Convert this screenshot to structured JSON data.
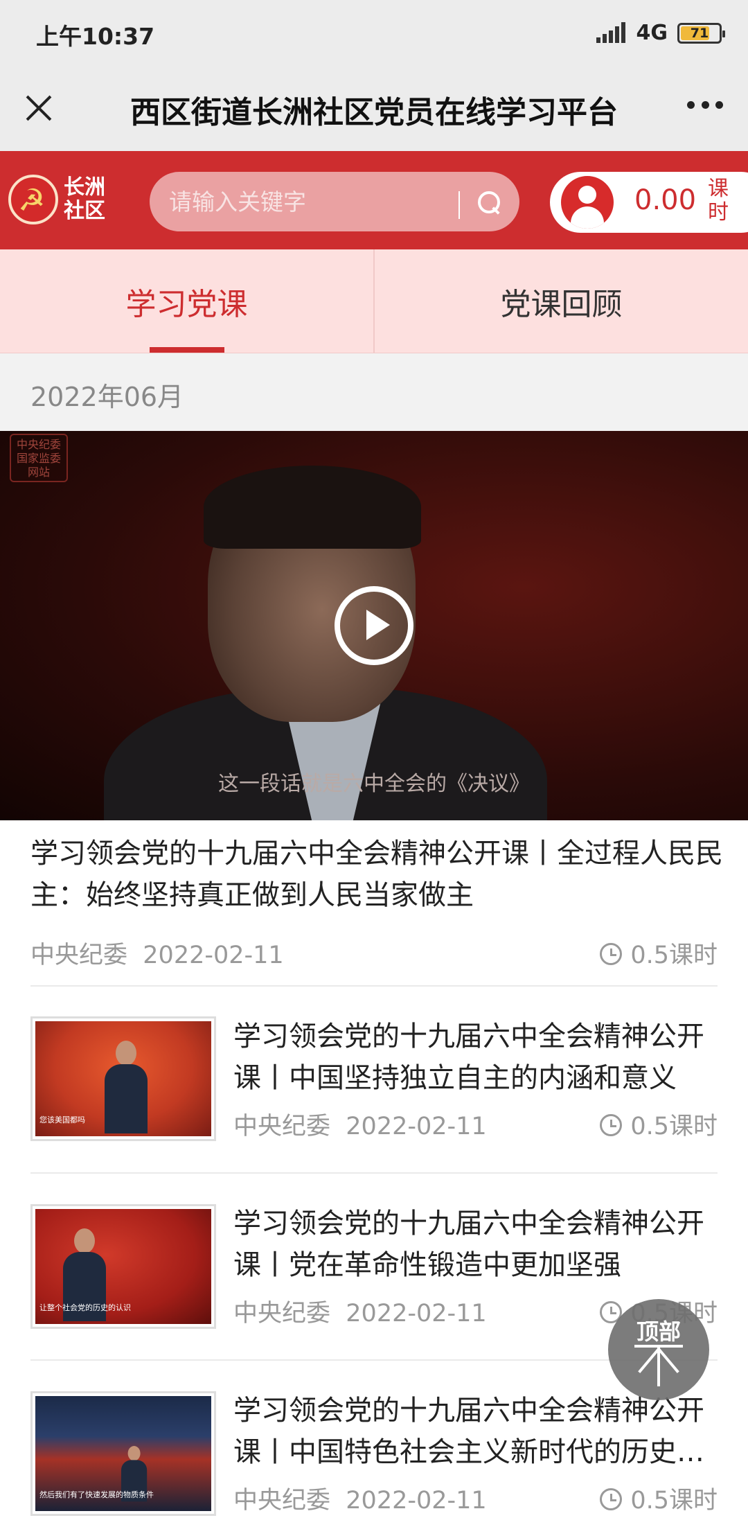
{
  "status_bar": {
    "time": "上午10:37",
    "network": "4G",
    "battery": "71",
    "battery_level": 0.71
  },
  "title_bar": {
    "title": "西区街道长洲社区党员在线学习平台"
  },
  "header": {
    "logo_text": "长洲社区",
    "search_placeholder": "请输入关键字",
    "hours_value": "0.00",
    "hours_unit": "课时",
    "accent_color": "#cd2d2f"
  },
  "tabs": [
    {
      "label": "学习党课",
      "active": true
    },
    {
      "label": "党课回顾",
      "active": false
    }
  ],
  "month_label": "2022年06月",
  "featured": {
    "subtitle": "这一段话就是六中全会的《决议》",
    "watermark": "中央纪委国家监委网站",
    "title": "学习领会党的十九届六中全会精神公开课丨全过程人民民主：始终坚持真正做到人民当家做主",
    "source": "中央纪委",
    "date": "2022-02-11",
    "hours": "0.5课时"
  },
  "courses": [
    {
      "title": "学习领会党的十九届六中全会精神公开课丨中国坚持独立自主的内涵和意义",
      "source": "中央纪委",
      "date": "2022-02-11",
      "hours": "0.5课时",
      "caption": "您该美国都吗"
    },
    {
      "title": "学习领会党的十九届六中全会精神公开课丨党在革命性锻造中更加坚强",
      "source": "中央纪委",
      "date": "2022-02-11",
      "hours": "0.5课时",
      "caption": "让整个社会党的历史的认识"
    },
    {
      "title": "学习领会党的十九届六中全会精神公开课丨中国特色社会主义新时代的历史方位",
      "source": "中央纪委",
      "date": "2022-02-11",
      "hours": "0.5课时",
      "caption": "然后我们有了快速发展的物质条件"
    }
  ],
  "back_to_top": "顶部"
}
